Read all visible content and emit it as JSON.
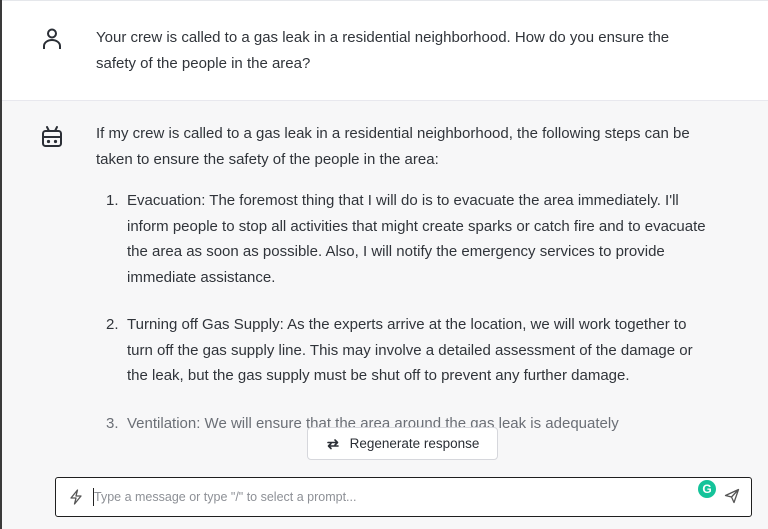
{
  "conversation": {
    "user_message": {
      "avatar_icon": "user-icon",
      "text": "Your crew is called to a gas leak in a residential neighborhood. How do you ensure the safety of the people in the area?"
    },
    "assistant_message": {
      "avatar_icon": "robot-icon",
      "intro": "If my crew is called to a gas leak in a residential neighborhood, the following steps can be taken to ensure the safety of the people in the area:",
      "steps": [
        {
          "number": "1.",
          "text": "Evacuation: The foremost thing that I will do is to evacuate the area immediately. I'll inform people to stop all activities that might create sparks or catch fire and to evacuate the area as soon as possible. Also, I will notify the emergency services to provide immediate assistance."
        },
        {
          "number": "2.",
          "text": "Turning off Gas Supply: As the experts arrive at the location, we will work together to turn off the gas supply line. This may involve a detailed assessment of the damage or the leak, but the gas supply must be shut off to prevent any further damage."
        },
        {
          "number": "3.",
          "text": "Ventilation: We will ensure that the area around the gas leak is adequately"
        }
      ]
    }
  },
  "regenerate": {
    "label": "Regenerate response",
    "icon": "refresh-icon"
  },
  "composer": {
    "placeholder": "Type a message or type \"/\" to select a prompt...",
    "value": "",
    "prompt_icon": "lightning-icon",
    "grammarly_badge": "G",
    "send_icon": "send-icon"
  },
  "colors": {
    "assistant_bg": "#f7f7f8",
    "grammarly": "#15c39a",
    "input_border": "#1f1f1f"
  }
}
